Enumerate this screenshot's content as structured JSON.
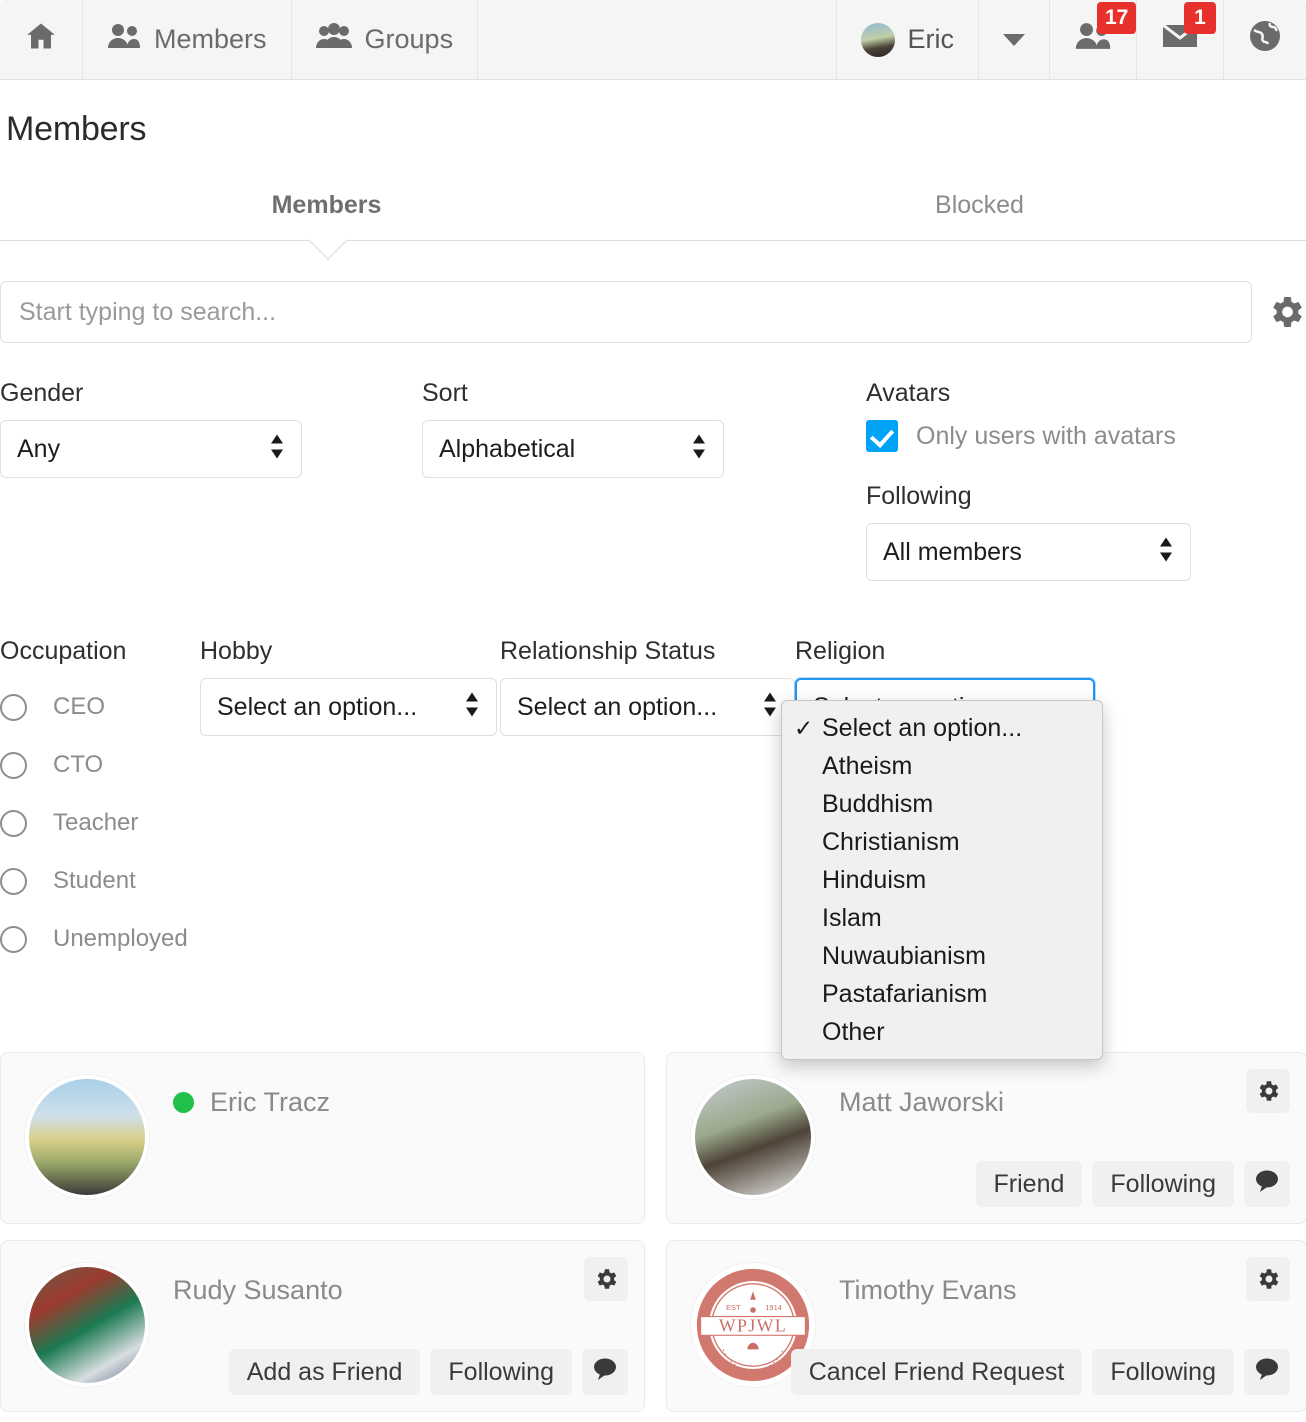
{
  "toolbar": {
    "home_icon": "home-icon",
    "items": [
      {
        "label": "Members",
        "icon": "members-icon"
      },
      {
        "label": "Groups",
        "icon": "groups-icon"
      }
    ],
    "user": {
      "name": "Eric",
      "avatar": "user-avatar"
    },
    "notifications": [
      {
        "icon": "friends-icon",
        "count": "17"
      },
      {
        "icon": "mail-icon",
        "count": "1"
      },
      {
        "icon": "globe-icon",
        "count": ""
      }
    ]
  },
  "page": {
    "title": "Members"
  },
  "tabs": [
    {
      "label": "Members",
      "active": true
    },
    {
      "label": "Blocked",
      "active": false
    }
  ],
  "search": {
    "placeholder": "Start typing to search...",
    "value": "",
    "gear_icon": "gear-icon"
  },
  "filters": {
    "gender": {
      "label": "Gender",
      "value": "Any"
    },
    "sort": {
      "label": "Sort",
      "value": "Alphabetical"
    },
    "avatars": {
      "label": "Avatars",
      "checkbox_label": "Only users with avatars",
      "checked": true
    },
    "following": {
      "label": "Following",
      "value": "All members"
    },
    "occupation": {
      "label": "Occupation",
      "options": [
        "CEO",
        "CTO",
        "Teacher",
        "Student",
        "Unemployed"
      ],
      "selected": ""
    },
    "hobby": {
      "label": "Hobby",
      "value": "Select an option..."
    },
    "relationship_status": {
      "label": "Relationship Status",
      "value": "Select an option..."
    },
    "religion": {
      "label": "Religion",
      "value": "Select an option...",
      "open": true,
      "selected_index": 0,
      "options": [
        "Select an option...",
        "Atheism",
        "Buddhism",
        "Christianism",
        "Hinduism",
        "Islam",
        "Nuwaubianism",
        "Pastafarianism",
        "Other"
      ]
    }
  },
  "members": [
    {
      "name": "Eric Tracz",
      "online": true,
      "avatar": "av-eric",
      "has_gear": false,
      "actions": []
    },
    {
      "name": "Matt Jaworski",
      "online": false,
      "avatar": "av-matt",
      "has_gear": true,
      "actions": [
        "Friend",
        "Following"
      ]
    },
    {
      "name": "Rudy Susanto",
      "online": false,
      "avatar": "av-rudy",
      "has_gear": true,
      "actions": [
        "Add as Friend",
        "Following"
      ]
    },
    {
      "name": "Timothy Evans",
      "online": false,
      "avatar": "av-tim",
      "avatar_text": "WPJWL",
      "avatar_sub_top": "EST",
      "avatar_sub_right": "1914",
      "has_gear": true,
      "actions": [
        "Cancel Friend Request",
        "Following"
      ]
    }
  ],
  "colors": {
    "accent_blue": "#00a3f5",
    "badge_red": "#e8312c",
    "online_green": "#21c04a",
    "focus_blue": "#2196f3"
  }
}
